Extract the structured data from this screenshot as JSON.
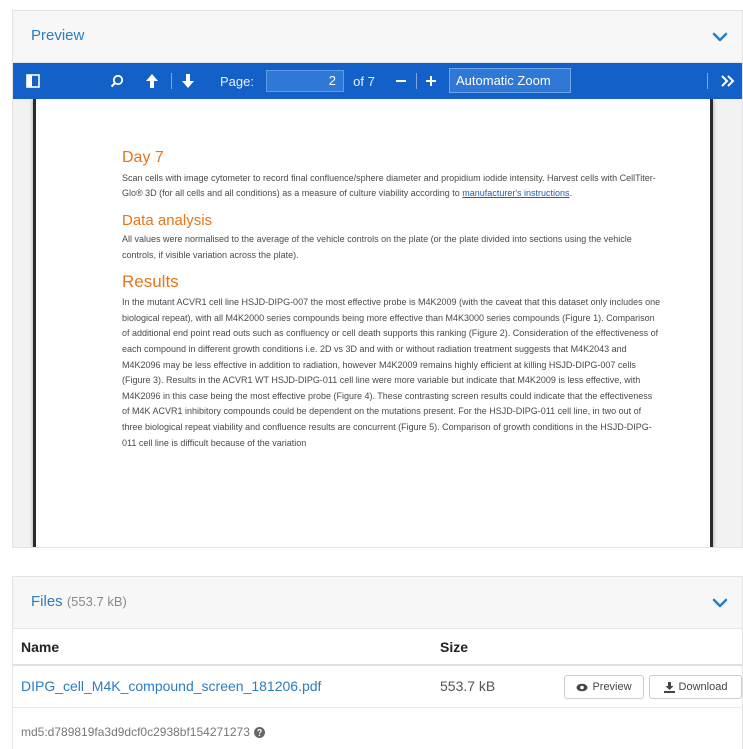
{
  "preview": {
    "title": "Preview",
    "toolbar": {
      "page_label": "Page:",
      "page_value": "2",
      "of_label": "of 7",
      "zoom_value": "Automatic Zoom"
    },
    "document": {
      "day7_heading": "Day 7",
      "day7_text_before": "Scan cells with image cytometer to record final confluence/sphere diameter and propidium iodide intensity. Harvest cells with CellTiter-Glo® 3D (for all cells and all conditions) as a measure of culture viability according to ",
      "day7_link": "manufacturer's instructions",
      "day7_text_after": ".",
      "data_heading": "Data analysis",
      "data_text": "All values were normalised to the average of the vehicle controls on the plate (or the plate divided into sections using the vehicle controls, if visible variation across the plate).",
      "results_heading": "Results",
      "results_text": "In the mutant ACVR1 cell line HSJD-DIPG-007 the most effective probe is M4K2009 (with the caveat that this dataset only includes one biological repeat), with all M4K2000 series compounds being more effective than M4K3000 series compounds (Figure 1). Comparison of additional end point read outs such as confluency or cell death supports this ranking (Figure 2). Consideration of the effectiveness of each compound in different growth conditions i.e. 2D vs 3D and with or without radiation treatment suggests that M4K2043 and M4K2096 may be less effective in addition to radiation, however M4K2009 remains highly efficient at killing HSJD-DIPG-007 cells (Figure 3). Results in the ACVR1 WT HSJD-DIPG-011 cell line were more variable but indicate that M4K2009 is less effective, with M4K2096 in this case being the most effective probe (Figure 4). These contrasting screen results could indicate that the effectiveness of M4K ACVR1 inhibitory compounds could be dependent on the mutations present. For the HSJD-DIPG-011 cell line, in two out of three biological repeat viability and confluence results are concurrent (Figure 5). Comparison of growth conditions in the HSJD-DIPG-011 cell line is difficult because of the variation"
    }
  },
  "files": {
    "title": "Files",
    "total_size": "(553.7 kB)",
    "columns": {
      "name": "Name",
      "size": "Size"
    },
    "rows": [
      {
        "name": "DIPG_cell_M4K_compound_screen_181206.pdf",
        "size": "553.7 kB",
        "preview_label": "Preview",
        "download_label": "Download"
      }
    ],
    "md5": "md5:d789819fa3d9dcf0c2938bf154271273"
  },
  "colors": {
    "toolbar": "#1361c8",
    "link": "#2a7dc0",
    "heading_orange": "#e8751a"
  }
}
